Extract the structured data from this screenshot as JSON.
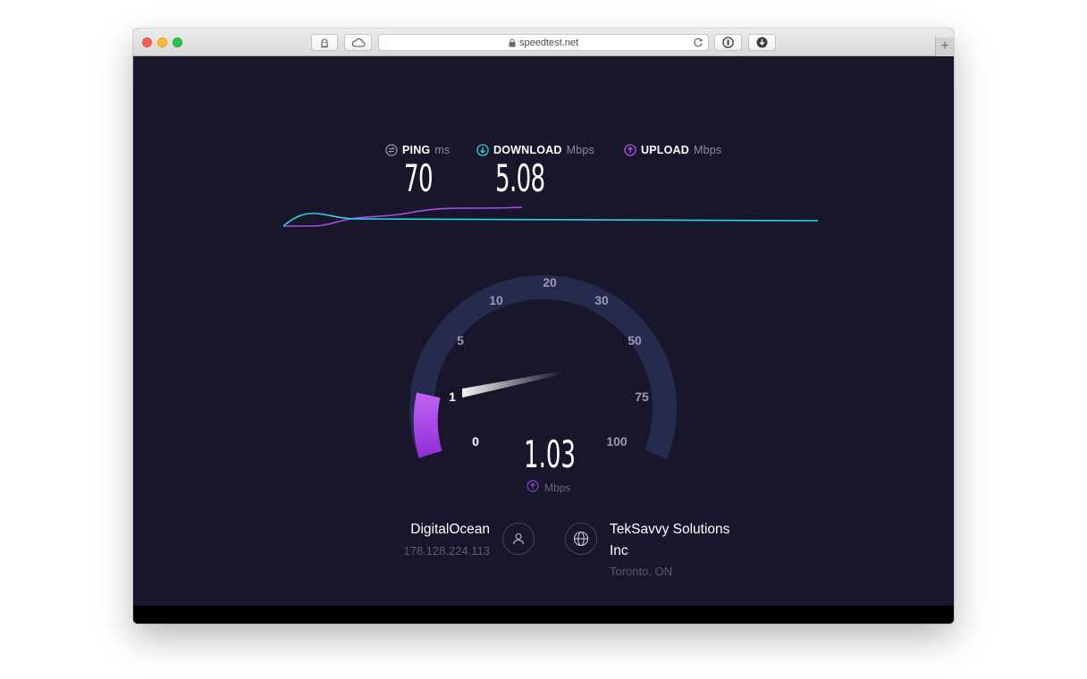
{
  "browser": {
    "url": "speedtest.net",
    "new_tab": "+"
  },
  "metrics": {
    "ping": {
      "label": "PING",
      "unit": "ms",
      "value": "70"
    },
    "download": {
      "label": "DOWNLOAD",
      "unit": "Mbps",
      "value": "5.08"
    },
    "upload": {
      "label": "UPLOAD",
      "unit": "Mbps"
    }
  },
  "gauge": {
    "ticks": [
      "0",
      "1",
      "5",
      "10",
      "20",
      "30",
      "50",
      "75",
      "100"
    ],
    "current_value": "1.03",
    "unit": "Mbps",
    "needle_tick_position": 1.03
  },
  "host": {
    "name": "DigitalOcean",
    "ip": "178.128.224.113"
  },
  "isp": {
    "name_line1": "TekSavvy Solutions",
    "name_line2": "Inc",
    "location": "Toronto, ON"
  },
  "colors": {
    "background": "#17162a",
    "download": "#2ad6e0",
    "upload": "#b44ff0",
    "gauge_track": "#252b4c"
  }
}
